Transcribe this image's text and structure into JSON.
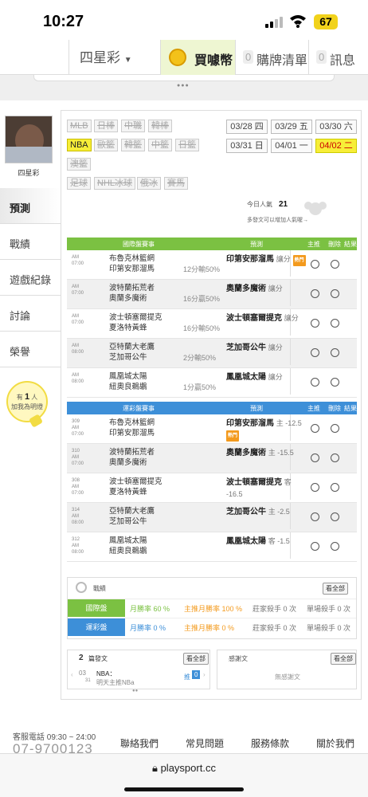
{
  "status_bar": {
    "time": "10:27",
    "battery": "67"
  },
  "nav": {
    "lottery_select": "四星彩",
    "coin_label": "買噱幣",
    "cart_count": "0",
    "cart_label": "購牌清單",
    "msg_count": "0",
    "msg_label": "訊息"
  },
  "user": {
    "name": "四星彩"
  },
  "side_menu": [
    "預測",
    "戰績",
    "遊戲紀錄",
    "討論",
    "榮譽"
  ],
  "bulb": {
    "line1": "有",
    "count": "1",
    "line1b": "人",
    "line2": "加我為明燈"
  },
  "leagues": [
    "MLB",
    "日棒",
    "中職",
    "韓棒",
    "NBA",
    "歐籃",
    "韓籃",
    "中籃",
    "日籃",
    "澳籃",
    "足球",
    "NHL冰球",
    "俄冰",
    "賽馬"
  ],
  "active_league": "NBA",
  "dates": [
    "03/28 四",
    "03/29 五",
    "03/30 六",
    "03/31 日",
    "04/01 一",
    "04/02 二"
  ],
  "popularity": {
    "label": "今日人氣",
    "value": "21",
    "hint": "多發文可以增加人氣喔→"
  },
  "intl_table": {
    "header": {
      "game": "國際盤賽事",
      "pick": "預測",
      "home": "主推",
      "del": "刪除",
      "result": "結果"
    },
    "rows": [
      {
        "ampm": "AM",
        "time": "07:00",
        "team1": "布魯克林籃網",
        "team2": "印第安那溜馬",
        "line": "12分輸50%",
        "pick": "印第安那溜馬",
        "pick_note": "讓分",
        "hot": "熱門"
      },
      {
        "ampm": "AM",
        "time": "07:00",
        "team1": "波特蘭拓荒者",
        "team2": "奧蘭多魔術",
        "line": "16分贏50%",
        "pick": "奧蘭多魔術",
        "pick_note": "讓分",
        "hot": ""
      },
      {
        "ampm": "AM",
        "time": "07:00",
        "team1": "波士頓塞爾提克",
        "team2": "夏洛特黃蜂",
        "line": "16分輸50%",
        "pick": "波士頓塞爾提克",
        "pick_note": "讓分",
        "hot": ""
      },
      {
        "ampm": "AM",
        "time": "08:00",
        "team1": "亞特蘭大老鷹",
        "team2": "芝加哥公牛",
        "line": "2分輸50%",
        "pick": "芝加哥公牛",
        "pick_note": "讓分",
        "hot": ""
      },
      {
        "ampm": "AM",
        "time": "08:00",
        "team1": "鳳凰城太陽",
        "team2": "紐奧良鵜鶘",
        "line": "1分贏50%",
        "pick": "鳳凰城太陽",
        "pick_note": "讓分",
        "hot": ""
      }
    ]
  },
  "lottery_table": {
    "header": {
      "game": "運彩盤賽事",
      "pick": "預測",
      "home": "主推",
      "del": "刪除",
      "result": "結果"
    },
    "rows": [
      {
        "num": "309",
        "ampm": "AM",
        "time": "07:00",
        "team1": "布魯克林籃網",
        "team2": "印第安那溜馬",
        "pick": "印第安那溜馬",
        "pick_note": "主 -12.5",
        "hot": "熱門"
      },
      {
        "num": "310",
        "ampm": "AM",
        "time": "07:00",
        "team1": "波特蘭拓荒者",
        "team2": "奧蘭多魔術",
        "pick": "奧蘭多魔術",
        "pick_note": "主 -15.5",
        "hot": ""
      },
      {
        "num": "308",
        "ampm": "AM",
        "time": "07:00",
        "team1": "波士頓塞爾提克",
        "team2": "夏洛特黃蜂",
        "pick": "波士頓塞爾提克",
        "pick_note": "客 -16.5",
        "hot": ""
      },
      {
        "num": "314",
        "ampm": "AM",
        "time": "08:00",
        "team1": "亞特蘭大老鷹",
        "team2": "芝加哥公牛",
        "pick": "芝加哥公牛",
        "pick_note": "主 -2.5",
        "hot": ""
      },
      {
        "num": "312",
        "ampm": "AM",
        "time": "08:00",
        "team1": "鳳凰城太陽",
        "team2": "紐奧良鵜鶘",
        "pick": "鳳凰城太陽",
        "pick_note": "客 -1.5",
        "hot": ""
      }
    ]
  },
  "stats": {
    "title": "戰績",
    "all_btn": "看全部",
    "rows": [
      {
        "tag": "國際盤",
        "month_rate": "月勝率 60 %",
        "home_rate": "主推月勝率 100 %",
        "streak": "莊家殺手 0 次",
        "single": "單場殺手 0 次"
      },
      {
        "tag": "運彩盤",
        "month_rate": "月勝率 0 %",
        "home_rate": "主推月勝率 0 %",
        "streak": "莊家殺手 0 次",
        "single": "單場殺手 0 次"
      }
    ]
  },
  "posts": {
    "count": "2",
    "count_label": "篇發文",
    "all_btn": "看全部",
    "date_m": "03",
    "date_d": "31",
    "post_title": "NBA：",
    "post_sub": "明天主推NBa",
    "reply_label": "推",
    "reply_count": "0",
    "ref_title": "感謝文",
    "ref_all": "看全部",
    "ref_empty": "無感謝文"
  },
  "footer": {
    "service": "客服電話 09:30 ~ 24:00",
    "phone": "07-9700123",
    "links": [
      "聯絡我們",
      "常見問題",
      "服務條款",
      "關於我們"
    ]
  },
  "url": "playsport.cc",
  "colors": {
    "green": "#7bc142",
    "blue": "#3d8fd8",
    "yellow": "#f7ee38"
  }
}
